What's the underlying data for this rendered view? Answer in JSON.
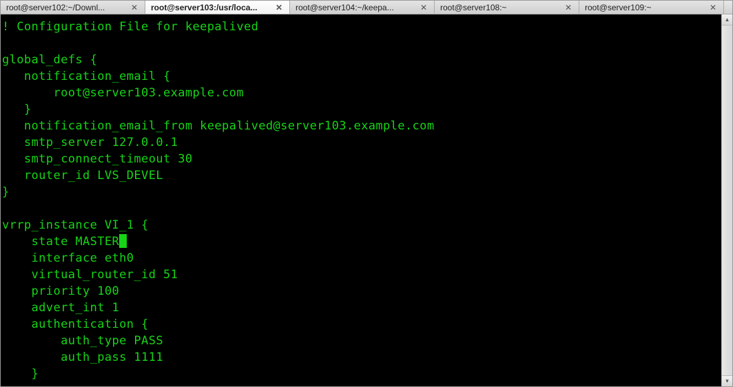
{
  "tabs": [
    {
      "label": "root@server102:~/Downl...",
      "active": false
    },
    {
      "label": "root@server103:/usr/loca...",
      "active": true
    },
    {
      "label": "root@server104:~/keepa...",
      "active": false
    },
    {
      "label": "root@server108:~",
      "active": false
    },
    {
      "label": "root@server109:~",
      "active": false
    }
  ],
  "close_glyph": "✕",
  "scroll_up_glyph": "▴",
  "scroll_down_glyph": "▾",
  "terminal": {
    "lines": [
      "! Configuration File for keepalived",
      "",
      "global_defs {",
      "   notification_email {",
      "       root@server103.example.com",
      "   }",
      "   notification_email_from keepalived@server103.example.com",
      "   smtp_server 127.0.0.1",
      "   smtp_connect_timeout 30",
      "   router_id LVS_DEVEL",
      "}",
      "",
      "vrrp_instance VI_1 {",
      "    state MASTER",
      "    interface eth0",
      "    virtual_router_id 51",
      "    priority 100",
      "    advert_int 1",
      "    authentication {",
      "        auth_type PASS",
      "        auth_pass 1111",
      "    }"
    ],
    "cursor_line_index": 13
  }
}
